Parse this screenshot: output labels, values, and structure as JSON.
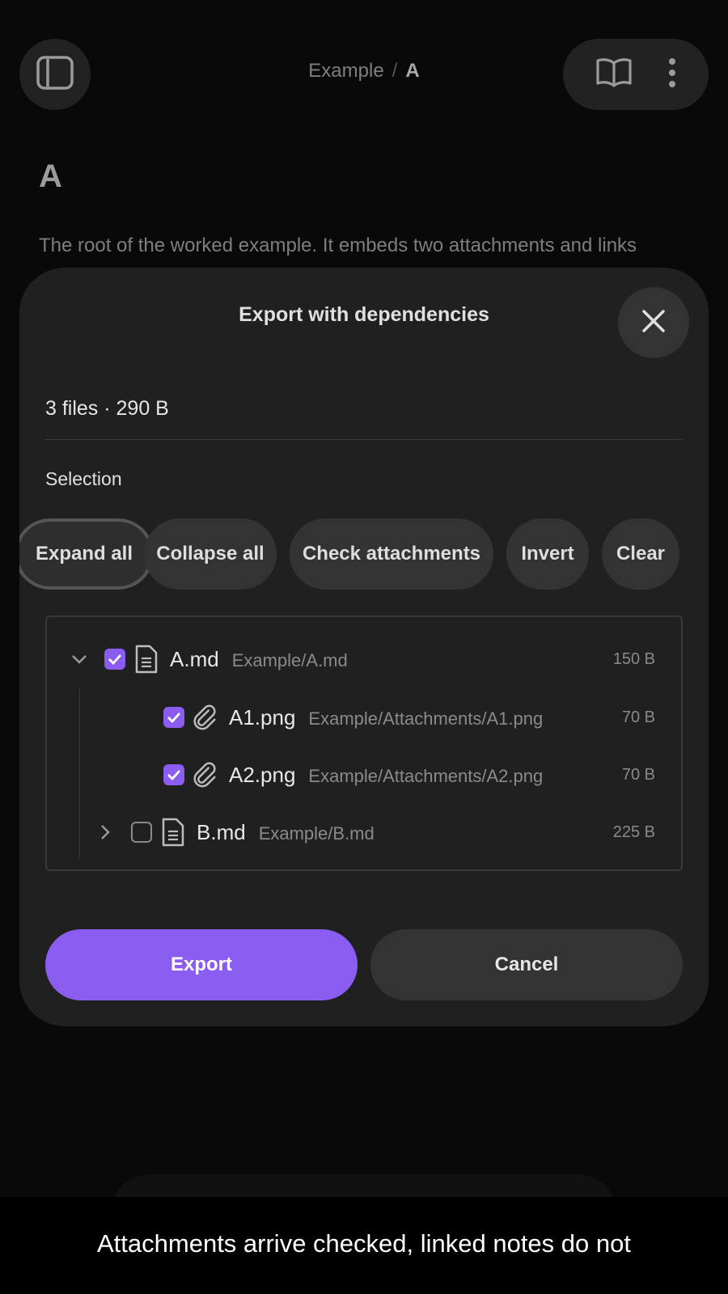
{
  "header": {
    "breadcrumb_parent": "Example",
    "breadcrumb_sep": "/",
    "breadcrumb_current": "A"
  },
  "note": {
    "title": "A",
    "text": "The root of the worked example. It embeds two attachments and links"
  },
  "modal": {
    "title": "Export with dependencies",
    "summary": "3 files · 290 B",
    "section_label": "Selection",
    "chips": [
      "Expand all",
      "Collapse all",
      "Check attachments",
      "Invert",
      "Clear"
    ],
    "tree": [
      {
        "name": "A.md",
        "path": "Example/A.md",
        "size": "150 B",
        "checked": true,
        "expanded": true,
        "type": "note"
      },
      {
        "name": "A1.png",
        "path": "Example/Attachments/A1.png",
        "size": "70 B",
        "checked": true,
        "type": "attachment"
      },
      {
        "name": "A2.png",
        "path": "Example/Attachments/A2.png",
        "size": "70 B",
        "checked": true,
        "type": "attachment"
      },
      {
        "name": "B.md",
        "path": "Example/B.md",
        "size": "225 B",
        "checked": false,
        "expanded": false,
        "type": "note"
      }
    ],
    "export_label": "Export",
    "cancel_label": "Cancel"
  },
  "toolbar": {
    "tab_count": "1"
  },
  "caption": "Attachments arrive checked, linked notes do not",
  "colors": {
    "accent": "#8b5cf0",
    "background": "#0b0b0b",
    "modal": "#202020"
  }
}
